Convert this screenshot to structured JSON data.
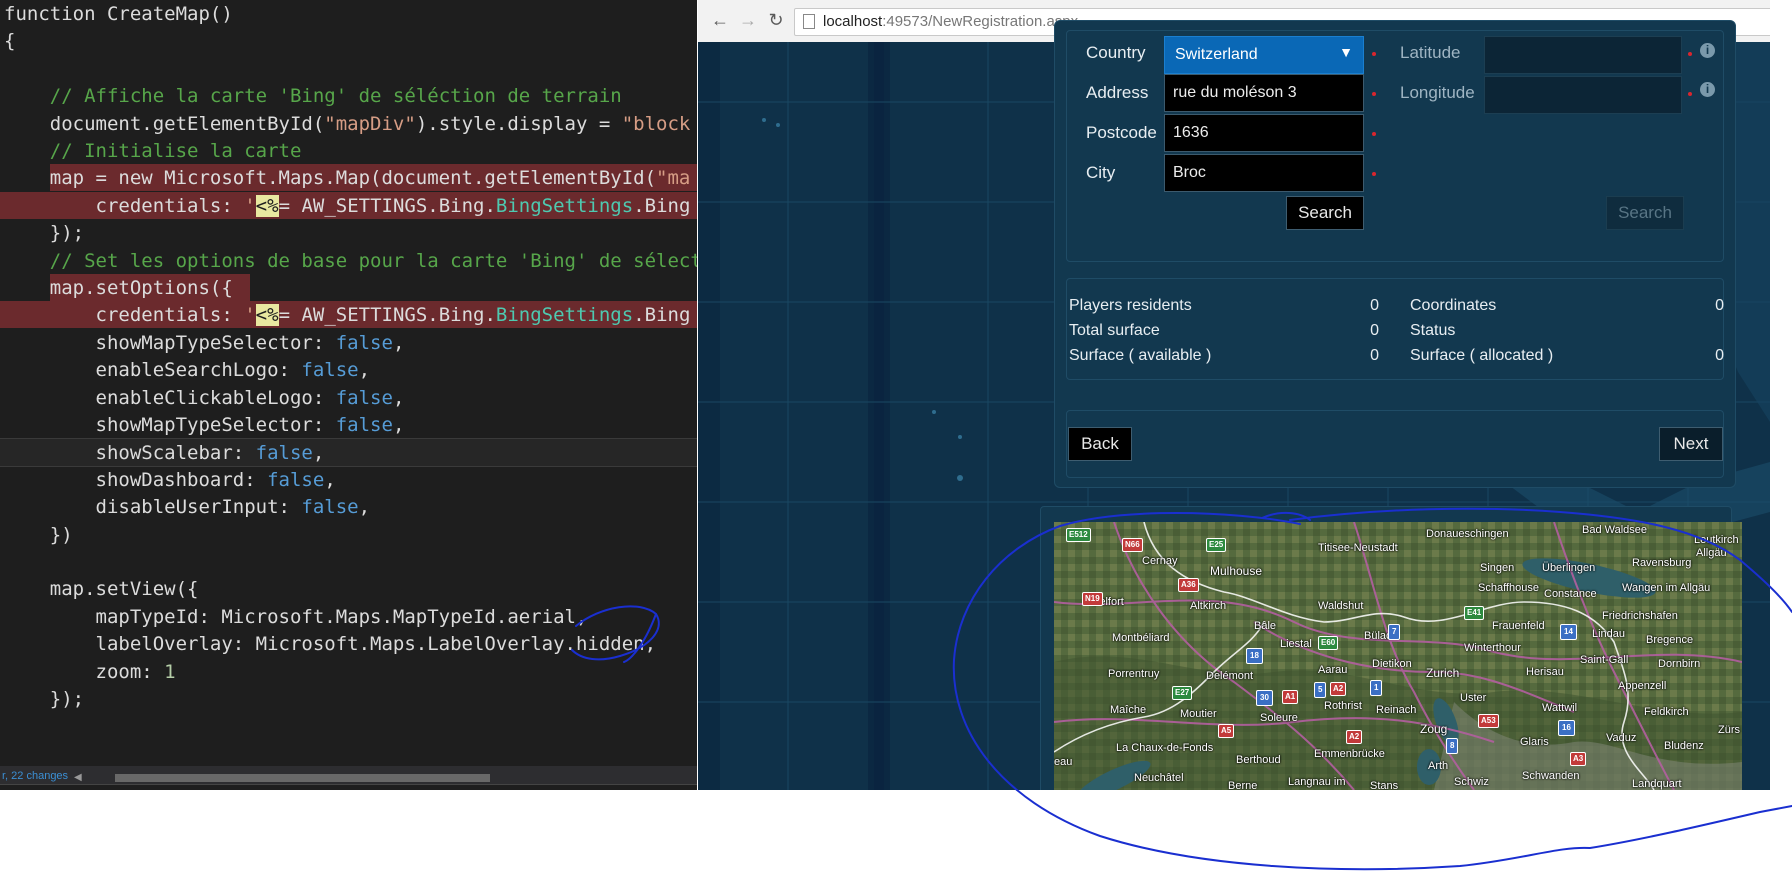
{
  "editor": {
    "lines": [
      [
        [
          "tok-kw",
          "function CreateMap()"
        ]
      ],
      [
        [
          "tok-kw",
          "{"
        ]
      ],
      [],
      [
        [
          "tok-kw",
          "    "
        ],
        [
          "tok-com",
          "// Affiche la carte 'Bing' de séléction de terrain"
        ]
      ],
      [
        [
          "tok-kw",
          "    document.getElementById("
        ],
        [
          "tok-str",
          "\"mapDiv\""
        ],
        [
          "tok-kw",
          ").style.display = "
        ],
        [
          "tok-str",
          "\"block"
        ]
      ],
      [
        [
          "tok-kw",
          "    "
        ],
        [
          "tok-com",
          "// Initialise la carte"
        ]
      ],
      [
        [
          "tok-kw",
          "    map = new Microsoft.Maps.Map(document.getElementById("
        ],
        [
          "tok-str",
          "\"ma"
        ]
      ],
      [
        [
          "tok-kw",
          "        credentials: "
        ],
        [
          "tok-str",
          "'"
        ],
        [
          "tok-aspx",
          "<%"
        ],
        [
          "tok-kw",
          "= AW_SETTINGS.Bing."
        ],
        [
          "tok-cls",
          "BingSettings"
        ],
        [
          "tok-kw",
          ".Bing"
        ]
      ],
      [
        [
          "tok-kw",
          "    });"
        ]
      ],
      [
        [
          "tok-kw",
          "    "
        ],
        [
          "tok-com",
          "// Set les options de base pour la carte 'Bing' de sélect"
        ]
      ],
      [
        [
          "tok-kw",
          "    map.setOptions({"
        ]
      ],
      [
        [
          "tok-kw",
          "        credentials: "
        ],
        [
          "tok-str",
          "'"
        ],
        [
          "tok-aspx",
          "<%"
        ],
        [
          "tok-kw",
          "= AW_SETTINGS.Bing."
        ],
        [
          "tok-cls",
          "BingSettings"
        ],
        [
          "tok-kw",
          ".Bing"
        ]
      ],
      [
        [
          "tok-kw",
          "        showMapTypeSelector: "
        ],
        [
          "tok-bool",
          "false"
        ],
        [
          "tok-kw",
          ","
        ]
      ],
      [
        [
          "tok-kw",
          "        enableSearchLogo: "
        ],
        [
          "tok-bool",
          "false"
        ],
        [
          "tok-kw",
          ","
        ]
      ],
      [
        [
          "tok-kw",
          "        enableClickableLogo: "
        ],
        [
          "tok-bool",
          "false"
        ],
        [
          "tok-kw",
          ","
        ]
      ],
      [
        [
          "tok-kw",
          "        showMapTypeSelector: "
        ],
        [
          "tok-bool",
          "false"
        ],
        [
          "tok-kw",
          ","
        ]
      ],
      [
        [
          "tok-kw",
          "        showScalebar: "
        ],
        [
          "tok-bool",
          "false"
        ],
        [
          "tok-kw",
          ","
        ]
      ],
      [
        [
          "tok-kw",
          "        showDashboard: "
        ],
        [
          "tok-bool",
          "false"
        ],
        [
          "tok-kw",
          ","
        ]
      ],
      [
        [
          "tok-kw",
          "        disableUserInput: "
        ],
        [
          "tok-bool",
          "false"
        ],
        [
          "tok-kw",
          ","
        ]
      ],
      [
        [
          "tok-kw",
          "    })"
        ]
      ],
      [],
      [
        [
          "tok-kw",
          "    map.setView({"
        ]
      ],
      [
        [
          "tok-kw",
          "        mapTypeId: Microsoft.Maps.MapTypeId.aerial,"
        ]
      ],
      [
        [
          "tok-kw",
          "        labelOverlay: Microsoft.Maps.LabelOverlay.hidden,"
        ]
      ],
      [
        [
          "tok-kw",
          "        zoom: "
        ],
        [
          "tok-num",
          "1"
        ]
      ],
      [
        [
          "tok-kw",
          "    });"
        ]
      ]
    ],
    "status_changes": "r, 22 changes"
  },
  "browser": {
    "url_host": "localhost",
    "url_path": ":49573/NewRegistration.aspx"
  },
  "form": {
    "country_label": "Country",
    "country_value": "Switzerland",
    "address_label": "Address",
    "address_value": "rue du moléson 3",
    "postcode_label": "Postcode",
    "postcode_value": "1636",
    "city_label": "City",
    "city_value": "Broc",
    "search_label": "Search",
    "latitude_label": "Latitude",
    "longitude_label": "Longitude",
    "search2_label": "Search"
  },
  "stats": {
    "players_label": "Players residents",
    "players_value": "0",
    "total_label": "Total surface",
    "total_value": "0",
    "available_label": "Surface ( available )",
    "available_value": "0",
    "coordinates_label": "Coordinates",
    "coordinates_value": "0",
    "status_label": "Status",
    "allocated_label": "Surface ( allocated )",
    "allocated_value": "0"
  },
  "nav": {
    "back_label": "Back",
    "next_label": "Next"
  },
  "map": {
    "places": [
      "Donaueschingen",
      "Bad Waldsee",
      "Leutkirch",
      "Allgäu",
      "Titisee-Neustadt",
      "Cernay",
      "Mulhouse",
      "Singen",
      "Überlingen",
      "Ravensburg",
      "Schaffhouse",
      "Constance",
      "Wangen im Allgäu",
      "Belfort",
      "Altkirch",
      "Waldshut",
      "Friedrichshafen",
      "Montbéliard",
      "Bâle",
      "Bülach",
      "Frauenfeld",
      "Lindau",
      "Bregence",
      "Liestal",
      "Winterthour",
      "Saint-Gall",
      "Dornbirn",
      "Porrentruy",
      "Delémont",
      "Aarau",
      "Dietikon",
      "Zurich",
      "Herisau",
      "Appenzell",
      "Maîche",
      "Moutier",
      "Soleure",
      "Rothrist",
      "Reinach",
      "Uster",
      "Wattwil",
      "Feldkirch",
      "Zürs",
      "La Chaux-de-Fonds",
      "Berthoud",
      "Emmenbrücke",
      "Zoug",
      "Glaris",
      "Vaduz",
      "Bludenz",
      "eau",
      "Neuchâtel",
      "Berne",
      "Langnau im",
      "Stans",
      "Arth",
      "Schwiz",
      "Schwanden",
      "Landquart"
    ],
    "roads": [
      "E512",
      "N66",
      "E25",
      "A36",
      "N19",
      "E41",
      "E60",
      "A2",
      "E27",
      "A1",
      "A5",
      "A3",
      "A53",
      "A2"
    ],
    "markers": [
      "7",
      "18",
      "14",
      "30",
      "5",
      "1",
      "16",
      "8"
    ]
  }
}
